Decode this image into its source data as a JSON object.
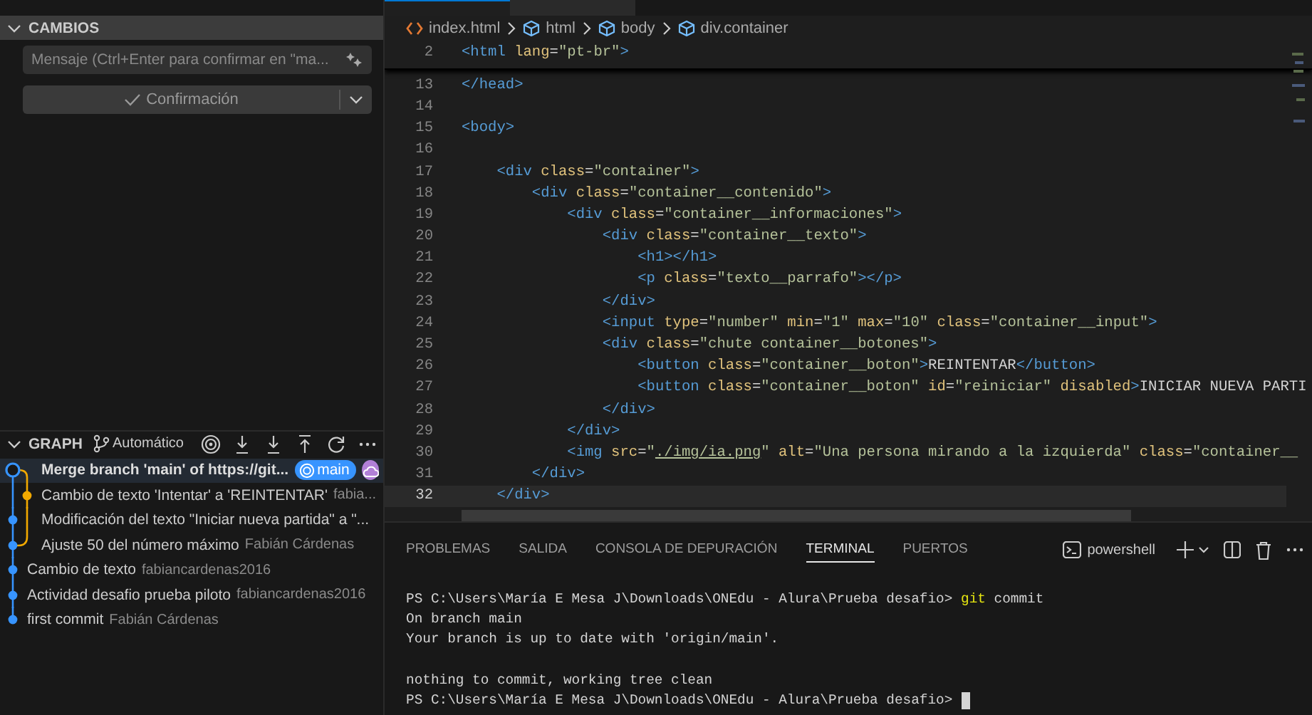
{
  "sidebar": {
    "changes": {
      "title": "CAMBIOS",
      "expanded": true,
      "message_field": {
        "placeholder": "Mensaje (Ctrl+Enter para confirmar en \"ma..."
      },
      "commit_button": {
        "label": "Confirmación"
      }
    },
    "graph": {
      "title": "GRAPH",
      "expanded": true,
      "branch_mode": "Automático",
      "commits": [
        {
          "kind": "merge",
          "message": "Merge branch 'main' of https://git...",
          "selected": true,
          "badge": "main",
          "color": "#3794ff"
        },
        {
          "kind": "side",
          "message": "Cambio de texto 'Intentar' a 'REINTENTAR'",
          "author": "fabia...",
          "selected": false,
          "color": "#f2a900"
        },
        {
          "kind": "lane",
          "message": "Modificación del texto \"Iniciar nueva partida\" a \"...",
          "selected": false,
          "color": "#3794ff"
        },
        {
          "kind": "lane",
          "message": "Ajuste 50 del número máximo",
          "author": "Fabián Cárdenas",
          "selected": false,
          "color": "#3794ff"
        },
        {
          "kind": "main",
          "message": "Cambio de texto",
          "author": "fabiancardenas2016",
          "selected": false,
          "color": "#3794ff"
        },
        {
          "kind": "main",
          "message": "Actividad desafio prueba piloto",
          "author": "fabiancardenas2016",
          "selected": false,
          "color": "#3794ff"
        },
        {
          "kind": "main",
          "message": "first commit",
          "author": "Fabián Cárdenas",
          "selected": false,
          "color": "#3794ff"
        }
      ]
    }
  },
  "editor": {
    "breadcrumbs": [
      {
        "kind": "file",
        "label": "index.html"
      },
      {
        "kind": "element",
        "label": "html"
      },
      {
        "kind": "element",
        "label": "body"
      },
      {
        "kind": "element",
        "label": "div.container"
      }
    ],
    "sticky_line": {
      "number": "2",
      "segments": [
        {
          "kind": "tag",
          "text": "<html "
        },
        {
          "kind": "attr",
          "text": "lang"
        },
        {
          "kind": "plain",
          "text": "="
        },
        {
          "kind": "string",
          "text": "\"pt-br\""
        },
        {
          "kind": "tag",
          "text": ">"
        }
      ]
    },
    "lines": [
      {
        "number": "13",
        "current": false,
        "segments": [
          {
            "kind": "tag",
            "text": "</head>"
          }
        ]
      },
      {
        "number": "14",
        "current": false
      },
      {
        "number": "15",
        "current": false,
        "segments": [
          {
            "kind": "tag",
            "text": "<body>"
          }
        ]
      },
      {
        "number": "16",
        "current": false
      },
      {
        "number": "17",
        "current": false,
        "segments": [
          {
            "kind": "tag",
            "text": "    <div "
          },
          {
            "kind": "attr",
            "text": "class"
          },
          {
            "kind": "plain",
            "text": "="
          },
          {
            "kind": "string",
            "text": "\"container\""
          },
          {
            "kind": "tag",
            "text": ">"
          }
        ]
      },
      {
        "number": "18",
        "current": false,
        "segments": [
          {
            "kind": "tag",
            "text": "        <div "
          },
          {
            "kind": "attr",
            "text": "class"
          },
          {
            "kind": "plain",
            "text": "="
          },
          {
            "kind": "string",
            "text": "\"container__contenido\""
          },
          {
            "kind": "tag",
            "text": ">"
          }
        ]
      },
      {
        "number": "19",
        "current": false,
        "segments": [
          {
            "kind": "tag",
            "text": "            <div "
          },
          {
            "kind": "attr",
            "text": "class"
          },
          {
            "kind": "plain",
            "text": "="
          },
          {
            "kind": "string",
            "text": "\"container__informaciones\""
          },
          {
            "kind": "tag",
            "text": ">"
          }
        ]
      },
      {
        "number": "20",
        "current": false,
        "segments": [
          {
            "kind": "tag",
            "text": "                <div "
          },
          {
            "kind": "attr",
            "text": "class"
          },
          {
            "kind": "plain",
            "text": "="
          },
          {
            "kind": "string",
            "text": "\"container__texto\""
          },
          {
            "kind": "tag",
            "text": ">"
          }
        ]
      },
      {
        "number": "21",
        "current": false,
        "segments": [
          {
            "kind": "tag",
            "text": "                    <h1></h1>"
          }
        ]
      },
      {
        "number": "22",
        "current": false,
        "segments": [
          {
            "kind": "tag",
            "text": "                    <p "
          },
          {
            "kind": "attr",
            "text": "class"
          },
          {
            "kind": "plain",
            "text": "="
          },
          {
            "kind": "string",
            "text": "\"texto__parrafo\""
          },
          {
            "kind": "tag",
            "text": "></p>"
          }
        ]
      },
      {
        "number": "23",
        "current": false,
        "segments": [
          {
            "kind": "tag",
            "text": "                </div>"
          }
        ]
      },
      {
        "number": "24",
        "current": false,
        "segments": [
          {
            "kind": "tag",
            "text": "                <input "
          },
          {
            "kind": "attr",
            "text": "type"
          },
          {
            "kind": "plain",
            "text": "="
          },
          {
            "kind": "string",
            "text": "\"number\" "
          },
          {
            "kind": "attr",
            "text": "min"
          },
          {
            "kind": "plain",
            "text": "="
          },
          {
            "kind": "string",
            "text": "\"1\" "
          },
          {
            "kind": "attr",
            "text": "max"
          },
          {
            "kind": "plain",
            "text": "="
          },
          {
            "kind": "string",
            "text": "\"10\" "
          },
          {
            "kind": "attr",
            "text": "class"
          },
          {
            "kind": "plain",
            "text": "="
          },
          {
            "kind": "string",
            "text": "\"container__input\""
          },
          {
            "kind": "tag",
            "text": ">"
          }
        ]
      },
      {
        "number": "25",
        "current": false,
        "segments": [
          {
            "kind": "tag",
            "text": "                <div "
          },
          {
            "kind": "attr",
            "text": "class"
          },
          {
            "kind": "plain",
            "text": "="
          },
          {
            "kind": "string",
            "text": "\"chute container__botones\""
          },
          {
            "kind": "tag",
            "text": ">"
          }
        ]
      },
      {
        "number": "26",
        "current": false,
        "segments": [
          {
            "kind": "tag",
            "text": "                    <button "
          },
          {
            "kind": "attr",
            "text": "class"
          },
          {
            "kind": "plain",
            "text": "="
          },
          {
            "kind": "string",
            "text": "\"container__boton\""
          },
          {
            "kind": "tag",
            "text": ">"
          },
          {
            "kind": "plain",
            "text": "REINTENTAR"
          },
          {
            "kind": "tag",
            "text": "</button>"
          }
        ]
      },
      {
        "number": "27",
        "current": false,
        "segments": [
          {
            "kind": "tag",
            "text": "                    <button "
          },
          {
            "kind": "attr",
            "text": "class"
          },
          {
            "kind": "plain",
            "text": "="
          },
          {
            "kind": "string",
            "text": "\"container__boton\" "
          },
          {
            "kind": "attr",
            "text": "id"
          },
          {
            "kind": "plain",
            "text": "="
          },
          {
            "kind": "string",
            "text": "\"reiniciar\" "
          },
          {
            "kind": "attr",
            "text": "disabled"
          },
          {
            "kind": "tag",
            "text": ">"
          },
          {
            "kind": "plain",
            "text": "INICIAR NUEVA PARTI"
          }
        ]
      },
      {
        "number": "28",
        "current": false,
        "segments": [
          {
            "kind": "tag",
            "text": "                </div>"
          }
        ]
      },
      {
        "number": "29",
        "current": false,
        "segments": [
          {
            "kind": "tag",
            "text": "            </div>"
          }
        ]
      },
      {
        "number": "30",
        "current": false,
        "segments": [
          {
            "kind": "tag",
            "text": "            <img "
          },
          {
            "kind": "attr",
            "text": "src"
          },
          {
            "kind": "plain",
            "text": "="
          },
          {
            "kind": "string",
            "text": "\""
          },
          {
            "kind": "link",
            "text": "./img/ia.png"
          },
          {
            "kind": "string",
            "text": "\" "
          },
          {
            "kind": "attr",
            "text": "alt"
          },
          {
            "kind": "plain",
            "text": "="
          },
          {
            "kind": "string",
            "text": "\"Una persona mirando a la izquierda\" "
          },
          {
            "kind": "attr",
            "text": "class"
          },
          {
            "kind": "plain",
            "text": "="
          },
          {
            "kind": "string",
            "text": "\"container__"
          }
        ]
      },
      {
        "number": "31",
        "current": false,
        "segments": [
          {
            "kind": "tag",
            "text": "        </div>"
          }
        ]
      },
      {
        "number": "32",
        "current": true,
        "segments": [
          {
            "kind": "tag",
            "text": "    </div>"
          }
        ]
      }
    ]
  },
  "panel": {
    "tabs": [
      {
        "label": "PROBLEMAS",
        "selected": false
      },
      {
        "label": "SALIDA",
        "selected": false
      },
      {
        "label": "CONSOLA DE DEPURACIÓN",
        "selected": false
      },
      {
        "label": "TERMINAL",
        "selected": true
      },
      {
        "label": "PUERTOS",
        "selected": false
      }
    ],
    "shell": "powershell",
    "terminal_lines": [
      {
        "cursor": false,
        "segments": [
          {
            "kind": "plain",
            "text": "PS C:\\Users\\María E Mesa J\\Downloads\\ONEdu - Alura\\Prueba desafio> "
          },
          {
            "kind": "command",
            "text": "git"
          },
          {
            "kind": "plain",
            "text": " commit"
          }
        ]
      },
      {
        "cursor": false,
        "segments": [
          {
            "kind": "plain",
            "text": "On branch main"
          }
        ]
      },
      {
        "cursor": false,
        "segments": [
          {
            "kind": "plain",
            "text": "Your branch is up to date with 'origin/main'."
          }
        ]
      },
      {
        "cursor": false
      },
      {
        "cursor": false,
        "segments": [
          {
            "kind": "plain",
            "text": "nothing to commit, working tree clean"
          }
        ]
      },
      {
        "cursor": true,
        "segments": [
          {
            "kind": "plain",
            "text": "PS C:\\Users\\María E Mesa J\\Downloads\\ONEdu - Alura\\Prueba desafio> "
          }
        ]
      }
    ]
  }
}
